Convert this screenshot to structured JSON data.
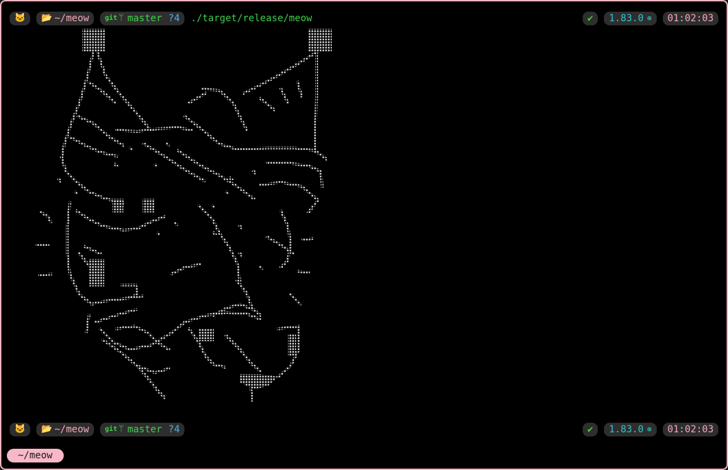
{
  "top_prompt": {
    "icon": "cat-face-icon",
    "directory": "~/meow",
    "git_label": "git",
    "branch": "master",
    "untracked": "?4",
    "command": "./target/release/meow",
    "status": "✔",
    "version": "1.83.0",
    "time": "01:02:03"
  },
  "bottom_prompt": {
    "icon": "cat-face-icon",
    "directory": "~/meow",
    "git_label": "git",
    "branch": "master",
    "untracked": "?4",
    "status": "✔",
    "version": "1.83.0",
    "time": "01:02:03"
  },
  "ascii_art": {
    "subject": "kuromi-character-braille-art",
    "color": "#ffffff"
  },
  "tab": {
    "label": "~/meow"
  },
  "colors": {
    "background": "#000000",
    "border": "#f2b6c2",
    "pill_bg": "#2e2e2e",
    "directory": "#f4a8b8",
    "git": "#3fcf4a",
    "untracked": "#4fb0e6",
    "version": "#2ec4c8",
    "tab_bg": "#f8b8c8"
  }
}
